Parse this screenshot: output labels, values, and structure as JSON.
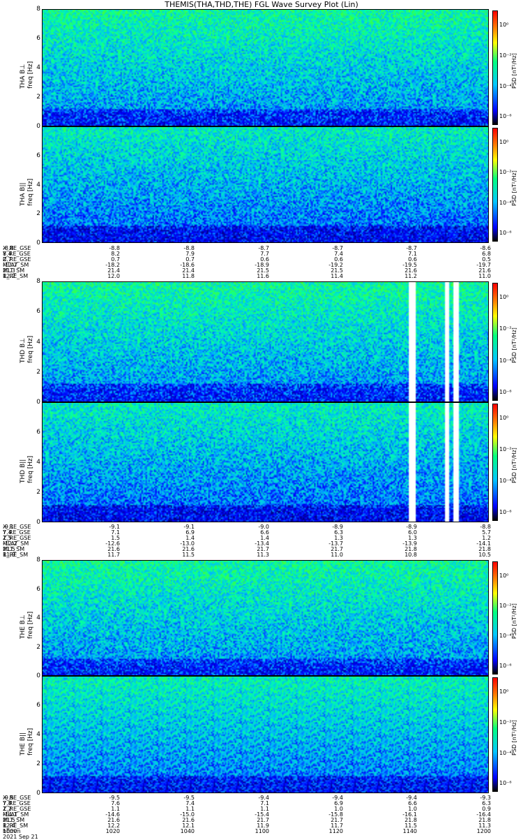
{
  "title": "THEMIS(THA,THD,THE) FGL Wave Survey Plot (Lin)",
  "chart_data": [
    {
      "type": "heatmap",
      "ylabel": "THA B⊥\nfreq [Hz]",
      "yticks": [
        "0",
        "2",
        "4",
        "6",
        "8"
      ],
      "cbar_label": "PSD [nT²/Hz]",
      "cbar_ticks": [
        "10⁰",
        "10⁻²",
        "10⁻⁴",
        "10⁻⁶"
      ]
    },
    {
      "type": "heatmap",
      "ylabel": "THA B||\nfreq [Hz]",
      "yticks": [
        "0",
        "2",
        "4",
        "6"
      ],
      "cbar_label": "PSD [nT²/Hz]",
      "cbar_ticks": [
        "10⁰",
        "10⁻²",
        "10⁻⁴",
        "10⁻⁶"
      ]
    },
    {
      "type": "heatmap",
      "ylabel": "THD B⊥\nfreq [Hz]",
      "yticks": [
        "0",
        "2",
        "4",
        "6",
        "8"
      ],
      "cbar_label": "PSD [nT²/Hz]",
      "cbar_ticks": [
        "10⁰",
        "10⁻²",
        "10⁻⁴",
        "10⁻⁶"
      ]
    },
    {
      "type": "heatmap",
      "ylabel": "THD B||\nfreq [Hz]",
      "yticks": [
        "0",
        "2",
        "4",
        "6"
      ],
      "cbar_label": "PSD [nT²/Hz]",
      "cbar_ticks": [
        "10⁰",
        "10⁻²",
        "10⁻⁴",
        "10⁻⁶"
      ]
    },
    {
      "type": "heatmap",
      "ylabel": "THE B⊥\nfreq [Hz]",
      "yticks": [
        "0",
        "2",
        "4",
        "6",
        "8"
      ],
      "cbar_label": "PSD [nT²/Hz]",
      "cbar_ticks": [
        "10⁰",
        "10⁻²",
        "10⁻⁴",
        "10⁻⁶"
      ]
    },
    {
      "type": "heatmap",
      "ylabel": "THE B||\nfreq [Hz]",
      "yticks": [
        "0",
        "2",
        "4",
        "6"
      ],
      "cbar_label": "PSD [nT²/Hz]",
      "cbar_ticks": [
        "10⁰",
        "10⁻²",
        "10⁻⁴",
        "10⁻⁶"
      ]
    }
  ],
  "eph_a": {
    "rows": [
      {
        "name": "X_RE_GSE",
        "vals": [
          "-8.8",
          "-8.8",
          "-8.8",
          "-8.7",
          "-8.7",
          "-8.7",
          "-8.6"
        ]
      },
      {
        "name": "Y_RE_GSE",
        "vals": [
          "8.4",
          "8.2",
          "7.9",
          "7.7",
          "7.4",
          "7.1",
          "6.8"
        ]
      },
      {
        "name": "Z_RE_GSE",
        "vals": [
          "0.7",
          "0.7",
          "0.7",
          "0.6",
          "0.6",
          "0.6",
          "0.5"
        ]
      },
      {
        "name": "MLAT_SM",
        "vals": [
          "-17.7",
          "-18.2",
          "-18.6",
          "-18.9",
          "-19.2",
          "-19.5",
          "-19.7"
        ]
      },
      {
        "name": "MLT_SM",
        "vals": [
          "21.3",
          "21.4",
          "21.4",
          "21.5",
          "21.5",
          "21.6",
          "21.6"
        ]
      },
      {
        "name": "R_RE_SM",
        "vals": [
          "12.2",
          "12.0",
          "11.8",
          "11.6",
          "11.4",
          "11.2",
          "11.0"
        ]
      }
    ]
  },
  "eph_d": {
    "rows": [
      {
        "name": "X_RE_GSE",
        "vals": [
          "-9.1",
          "-9.1",
          "-9.1",
          "-9.0",
          "-8.9",
          "-8.9",
          "-8.8"
        ]
      },
      {
        "name": "Y_RE_GSE",
        "vals": [
          "7.4",
          "7.1",
          "6.9",
          "6.6",
          "6.3",
          "6.0",
          "5.7"
        ]
      },
      {
        "name": "Z_RE_GSE",
        "vals": [
          "1.5",
          "1.5",
          "1.4",
          "1.4",
          "1.3",
          "1.3",
          "1.2"
        ]
      },
      {
        "name": "MLAT_SM",
        "vals": [
          "-12.2",
          "-12.6",
          "-13.0",
          "-13.4",
          "-13.7",
          "-13.9",
          "-14.1"
        ]
      },
      {
        "name": "MLT_SM",
        "vals": [
          "21.5",
          "21.6",
          "21.6",
          "21.7",
          "21.7",
          "21.8",
          "21.8"
        ]
      },
      {
        "name": "R_RE_SM",
        "vals": [
          "11.9",
          "11.7",
          "11.5",
          "11.3",
          "11.0",
          "10.8",
          "10.5"
        ]
      }
    ]
  },
  "eph_e": {
    "rows": [
      {
        "name": "X_RE_GSE",
        "vals": [
          "-9.5",
          "-9.5",
          "-9.5",
          "-9.4",
          "-9.4",
          "-9.4",
          "-9.3"
        ]
      },
      {
        "name": "Y_RE_GSE",
        "vals": [
          "7.8",
          "7.6",
          "7.4",
          "7.1",
          "6.9",
          "6.6",
          "6.3"
        ]
      },
      {
        "name": "Z_RE_GSE",
        "vals": [
          "1.2",
          "1.1",
          "1.1",
          "1.1",
          "1.0",
          "1.0",
          "0.9"
        ]
      },
      {
        "name": "MLAT_SM",
        "vals": [
          "-14.1",
          "-14.6",
          "-15.0",
          "-15.4",
          "-15.8",
          "-16.1",
          "-16.4"
        ]
      },
      {
        "name": "MLT_SM",
        "vals": [
          "21.5",
          "21.6",
          "21.6",
          "21.7",
          "21.7",
          "21.8",
          "21.8"
        ]
      },
      {
        "name": "R_RE_SM",
        "vals": [
          "12.4",
          "12.2",
          "12.1",
          "11.9",
          "11.7",
          "11.5",
          "11.3"
        ]
      },
      {
        "name": "hhmm",
        "vals": [
          "1000",
          "1020",
          "1040",
          "1100",
          "1120",
          "1140",
          "1200"
        ]
      }
    ],
    "date": "2021 Sep 21"
  }
}
